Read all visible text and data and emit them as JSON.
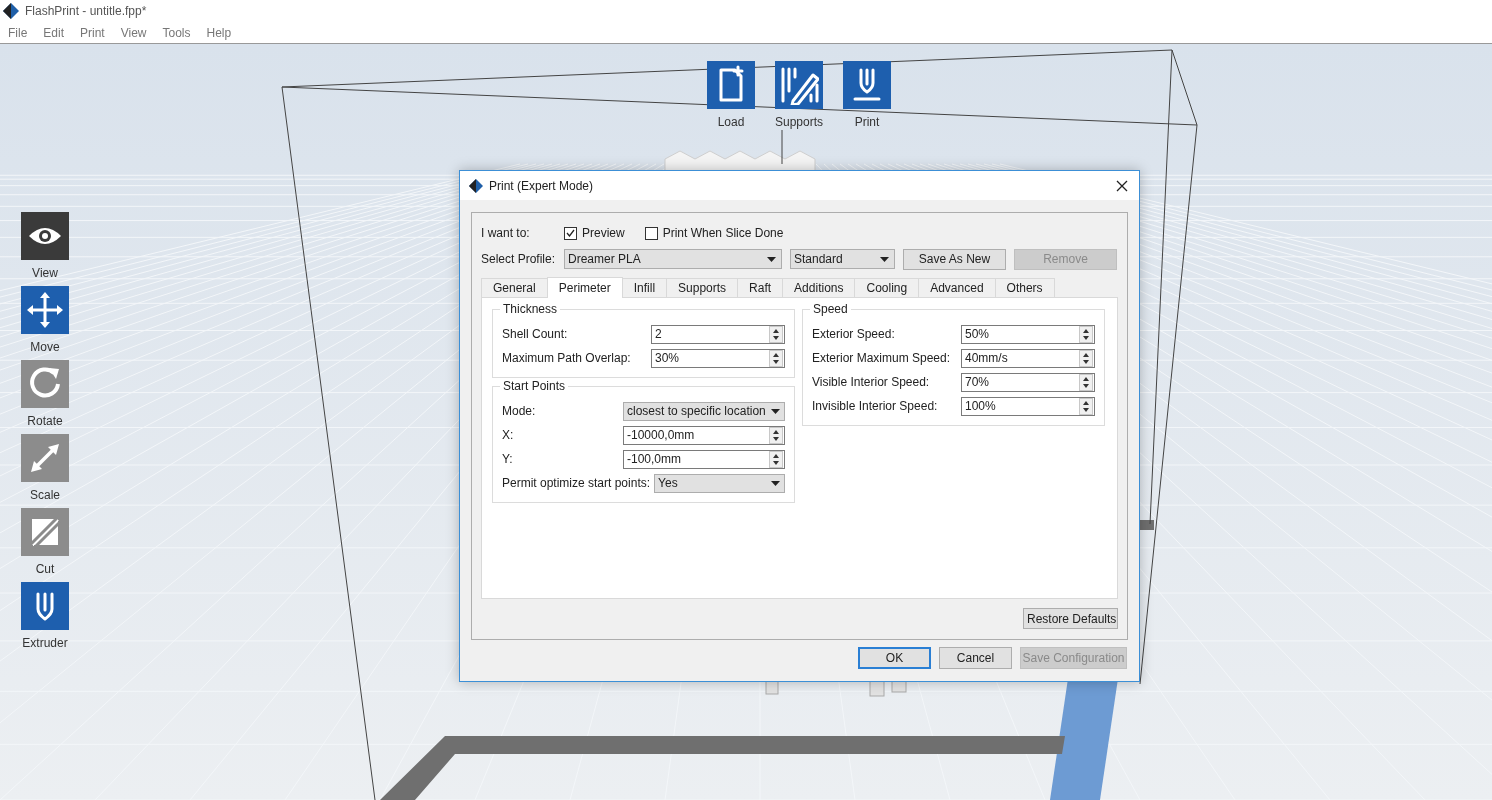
{
  "window": {
    "title": "FlashPrint - untitle.fpp*"
  },
  "menu": [
    {
      "label": "File"
    },
    {
      "label": "Edit"
    },
    {
      "label": "Print"
    },
    {
      "label": "View"
    },
    {
      "label": "Tools"
    },
    {
      "label": "Help"
    }
  ],
  "top_toolbar": [
    {
      "kind": "load",
      "label": "Load"
    },
    {
      "kind": "supports",
      "label": "Supports"
    },
    {
      "kind": "print",
      "label": "Print"
    }
  ],
  "left_toolbar": [
    {
      "kind": "view",
      "label": "View",
      "selected": true,
      "disabled": false
    },
    {
      "kind": "move",
      "label": "Move",
      "selected": false,
      "disabled": false
    },
    {
      "kind": "rotate",
      "label": "Rotate",
      "selected": false,
      "disabled": true
    },
    {
      "kind": "scale",
      "label": "Scale",
      "selected": false,
      "disabled": true
    },
    {
      "kind": "cut",
      "label": "Cut",
      "selected": false,
      "disabled": true
    },
    {
      "kind": "extruder",
      "label": "Extruder",
      "selected": false,
      "disabled": false
    }
  ],
  "dialog": {
    "title": "Print (Expert Mode)",
    "intent": {
      "label": "I want to:",
      "options": [
        {
          "label": "Preview",
          "checked": true
        },
        {
          "label": "Print When Slice Done",
          "checked": false
        }
      ]
    },
    "profile": {
      "label": "Select Profile:",
      "dropdowns": [
        {
          "value": "Dreamer PLA"
        },
        {
          "value": "Standard"
        }
      ],
      "buttons": [
        {
          "label": "Save As New",
          "disabled": false
        },
        {
          "label": "Remove",
          "disabled": true
        }
      ]
    },
    "tabs": [
      {
        "label": "General",
        "selected": false
      },
      {
        "label": "Perimeter",
        "selected": true
      },
      {
        "label": "Infill",
        "selected": false
      },
      {
        "label": "Supports",
        "selected": false
      },
      {
        "label": "Raft",
        "selected": false
      },
      {
        "label": "Additions",
        "selected": false
      },
      {
        "label": "Cooling",
        "selected": false
      },
      {
        "label": "Advanced",
        "selected": false
      },
      {
        "label": "Others",
        "selected": false
      }
    ],
    "columns": [
      [
        {
          "title": "Thickness",
          "fields": [
            {
              "kind": "spin",
              "label": "Shell Count:",
              "value": "2"
            },
            {
              "kind": "spin",
              "label": "Maximum Path Overlap:",
              "value": "30%"
            }
          ]
        },
        {
          "title": "Start Points",
          "fields": [
            {
              "kind": "dropdown",
              "label": "Mode:",
              "value": "closest to specific location"
            },
            {
              "kind": "spin",
              "label": "X:",
              "value": "-10000,0mm"
            },
            {
              "kind": "spin",
              "label": "Y:",
              "value": "-100,0mm"
            },
            {
              "kind": "dropdown",
              "label": "Permit optimize start points:",
              "value": "Yes"
            }
          ]
        }
      ],
      [
        {
          "title": "Speed",
          "fields": [
            {
              "kind": "spin",
              "label": "Exterior Speed:",
              "value": "50%"
            },
            {
              "kind": "spin",
              "label": "Exterior Maximum Speed:",
              "value": "40mm/s"
            },
            {
              "kind": "spin",
              "label": "Visible Interior Speed:",
              "value": "70%"
            },
            {
              "kind": "spin",
              "label": "Invisible Interior Speed:",
              "value": "100%"
            }
          ]
        }
      ]
    ],
    "restore_button": {
      "label": "Restore Defaults"
    },
    "buttons": [
      {
        "label": "OK",
        "default": true,
        "disabled": false
      },
      {
        "label": "Cancel",
        "default": false,
        "disabled": false
      },
      {
        "label": "Save Configuration",
        "default": false,
        "disabled": true
      }
    ]
  }
}
